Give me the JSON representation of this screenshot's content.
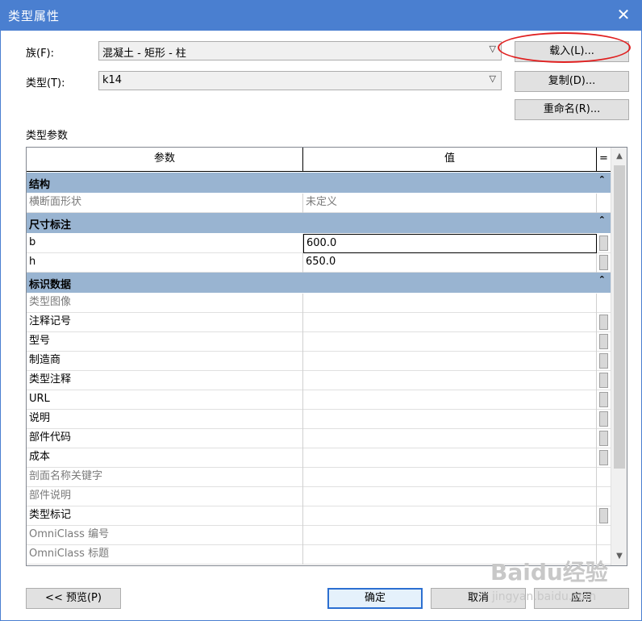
{
  "window": {
    "title": "类型属性",
    "close_glyph": "✕"
  },
  "family": {
    "label": "族(F):",
    "value": "混凝土 - 矩形 - 柱"
  },
  "type": {
    "label": "类型(T):",
    "value": "k14"
  },
  "buttons": {
    "load": "载入(L)...",
    "duplicate": "复制(D)...",
    "rename": "重命名(R)...",
    "preview": "<< 预览(P)",
    "ok": "确定",
    "cancel": "取消",
    "apply": "应用"
  },
  "section_label": "类型参数",
  "table": {
    "headers": {
      "param": "参数",
      "value": "值",
      "eq": "="
    },
    "groups": [
      {
        "name": "结构",
        "rows": [
          {
            "param": "横断面形状",
            "value": "未定义",
            "gray": true
          }
        ]
      },
      {
        "name": "尺寸标注",
        "rows": [
          {
            "param": "b",
            "value": "600.0"
          },
          {
            "param": "h",
            "value": "650.0"
          }
        ]
      },
      {
        "name": "标识数据",
        "rows": [
          {
            "param": "类型图像",
            "value": "",
            "gray": true
          },
          {
            "param": "注释记号",
            "value": ""
          },
          {
            "param": "型号",
            "value": ""
          },
          {
            "param": "制造商",
            "value": ""
          },
          {
            "param": "类型注释",
            "value": ""
          },
          {
            "param": "URL",
            "value": ""
          },
          {
            "param": "说明",
            "value": ""
          },
          {
            "param": "部件代码",
            "value": ""
          },
          {
            "param": "成本",
            "value": ""
          },
          {
            "param": "剖面名称关键字",
            "value": "",
            "gray": true
          },
          {
            "param": "部件说明",
            "value": "",
            "gray": true
          },
          {
            "param": "类型标记",
            "value": ""
          },
          {
            "param": "OmniClass 编号",
            "value": "",
            "gray": true
          },
          {
            "param": "OmniClass 标题",
            "value": "",
            "gray": true
          }
        ]
      }
    ]
  },
  "watermark": {
    "brand": "Baidu经验",
    "url": "jingyan.baidu.com"
  },
  "colors": {
    "titlebar": "#4a7fd0",
    "group_header": "#99b4d1",
    "highlight_oval": "#e02020"
  }
}
